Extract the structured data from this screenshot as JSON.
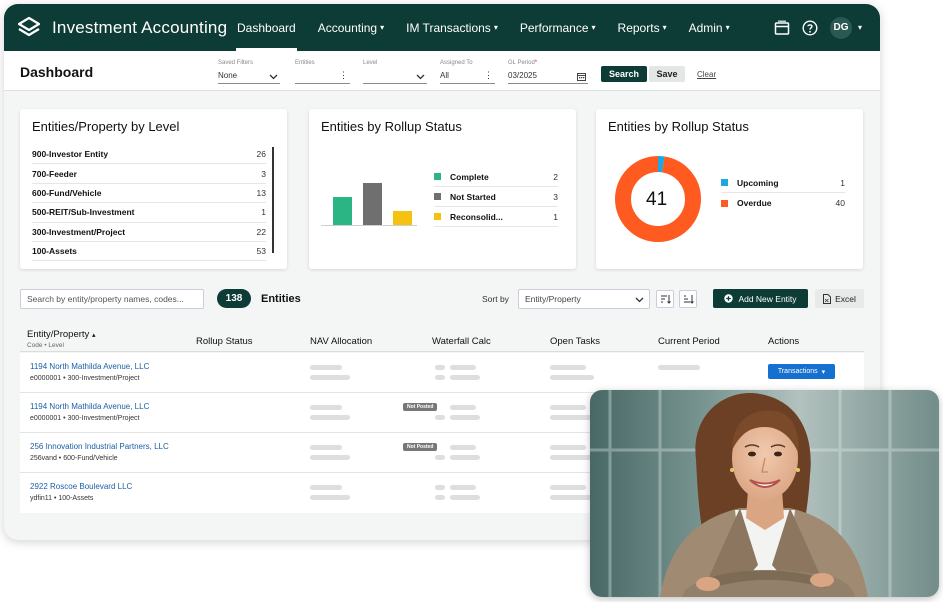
{
  "app": {
    "title": "Investment Accounting"
  },
  "nav": {
    "items": [
      {
        "label": "Dashboard",
        "caret": ""
      },
      {
        "label": "Accounting",
        "caret": "▾"
      },
      {
        "label": "IM Transactions",
        "caret": "▾"
      },
      {
        "label": "Performance",
        "caret": "▾"
      },
      {
        "label": "Reports",
        "caret": "▾"
      },
      {
        "label": "Admin",
        "caret": "▾"
      }
    ],
    "user_initials": "DG"
  },
  "filters": {
    "page_title": "Dashboard",
    "saved_filters_label": "Saved Filters",
    "saved_filters_value": "None",
    "entities_label": "Entities",
    "level_label": "Level",
    "assigned_to_label": "Assigned To",
    "assigned_to_value": "All",
    "gl_period_label": "GL Period",
    "gl_period_required": "*",
    "gl_period_value": "03/2025",
    "search_label": "Search",
    "save_label": "Save",
    "clear_label": "Clear"
  },
  "cards": {
    "levels": {
      "title": "Entities/Property by Level",
      "rows": [
        {
          "name": "900-Investor Entity",
          "count": "26"
        },
        {
          "name": "700-Feeder",
          "count": "3"
        },
        {
          "name": "600-Fund/Vehicle",
          "count": "13"
        },
        {
          "name": "500-REIT/Sub-Investment",
          "count": "1"
        },
        {
          "name": "300-Investment/Project",
          "count": "22"
        },
        {
          "name": "100-Assets",
          "count": "53"
        }
      ]
    },
    "rollup_bar": {
      "title": "Entities by Rollup Status",
      "legend": [
        {
          "name": "Complete",
          "count": "2",
          "color": "#2bb584"
        },
        {
          "name": "Not Started",
          "count": "3",
          "color": "#6f6f6f"
        },
        {
          "name": "Reconsolid...",
          "count": "1",
          "color": "#f5c211"
        }
      ]
    },
    "rollup_donut": {
      "title": "Entities by Rollup Status",
      "total": "41",
      "legend": [
        {
          "name": "Upcoming",
          "count": "1",
          "color": "#1ea7e1"
        },
        {
          "name": "Overdue",
          "count": "40",
          "color": "#ff5a1f"
        }
      ]
    }
  },
  "chart_data": [
    {
      "type": "bar",
      "title": "Entities by Rollup Status",
      "categories": [
        "Complete",
        "Not Started",
        "Reconsolid..."
      ],
      "values": [
        2,
        3,
        1
      ],
      "colors": [
        "#2bb584",
        "#6f6f6f",
        "#f5c211"
      ],
      "legend": "right"
    },
    {
      "type": "pie",
      "title": "Entities by Rollup Status",
      "categories": [
        "Upcoming",
        "Overdue"
      ],
      "values": [
        1,
        40
      ],
      "colors": [
        "#1ea7e1",
        "#ff5a1f"
      ],
      "center_label": "41",
      "legend": "right"
    }
  ],
  "table_controls": {
    "search_placeholder": "Search by entity/property names, codes...",
    "entity_count": "138",
    "entity_count_label": "Entities",
    "sort_label": "Sort by",
    "sort_value": "Entity/Property",
    "add_label": "Add New Entity",
    "excel_label": "Excel"
  },
  "table": {
    "headers": {
      "entity": "Entity/Property",
      "entity_sort": "▴",
      "entity_sub": "Code • Level",
      "rollup": "Rollup Status",
      "nav": "NAV Allocation",
      "waterfall": "Waterfall Calc",
      "open_tasks": "Open Tasks",
      "current_period": "Current Period",
      "actions": "Actions"
    },
    "rows": [
      {
        "name": "1194 North Mathilda Avenue, LLC",
        "sub": "e0000001 • 300-Investment/Project",
        "badge": "",
        "action": "Transactions"
      },
      {
        "name": "1194 North Mathilda Avenue, LLC",
        "sub": "e0000001 • 300-Investment/Project",
        "badge": "Not Posted",
        "action": ""
      },
      {
        "name": "256 Innovation Industrial Partners, LLC",
        "sub": "256vand • 600-Fund/Vehicle",
        "badge": "Not Posted",
        "action": ""
      },
      {
        "name": "2922 Roscoe Boulevard LLC",
        "sub": "ydfin11 • 100-Assets",
        "badge": "",
        "action": ""
      }
    ]
  }
}
